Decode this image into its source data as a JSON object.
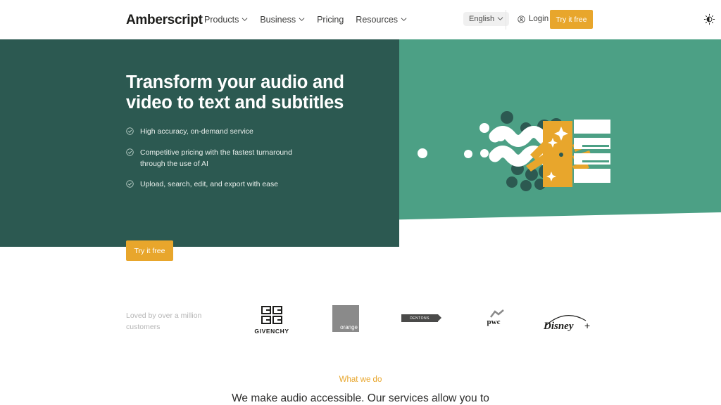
{
  "header": {
    "logo": "Amberscript",
    "nav": [
      {
        "label": "Products",
        "has_chevron": true
      },
      {
        "label": "Business",
        "has_chevron": true
      },
      {
        "label": "Pricing",
        "has_chevron": false
      },
      {
        "label": "Resources",
        "has_chevron": true
      }
    ],
    "language": "English",
    "login": "Login",
    "cta": "Try it free",
    "theme_icon": "brightness-icon"
  },
  "hero": {
    "title_line1": "Transform your audio and",
    "title_line2": "video to text and subtitles",
    "bullets": [
      "High accuracy, on-demand service",
      "Competitive pricing with the fastest turnaround through the use of AI",
      "Upload, search, edit, and export with ease"
    ],
    "cta": "Try it free"
  },
  "logos": {
    "caption": "Loved by over a million customers",
    "items": [
      {
        "name": "givenchy",
        "label": "GIVENCHY"
      },
      {
        "name": "orange",
        "label": "orange"
      },
      {
        "name": "dentons",
        "label": "DENTONS"
      },
      {
        "name": "pwc",
        "label": "pwc"
      },
      {
        "name": "disney-plus",
        "label": "Disney+"
      }
    ]
  },
  "what_we_do": {
    "eyebrow": "What we do",
    "heading": "We make audio accessible. Our services allow you to"
  },
  "colors": {
    "dark_green": "#2C5951",
    "mid_green": "#4CA085",
    "orange": "#E8A62C",
    "white": "#FFFFFF",
    "text_dark": "#1D1D1B",
    "muted": "#B5B5B5"
  }
}
